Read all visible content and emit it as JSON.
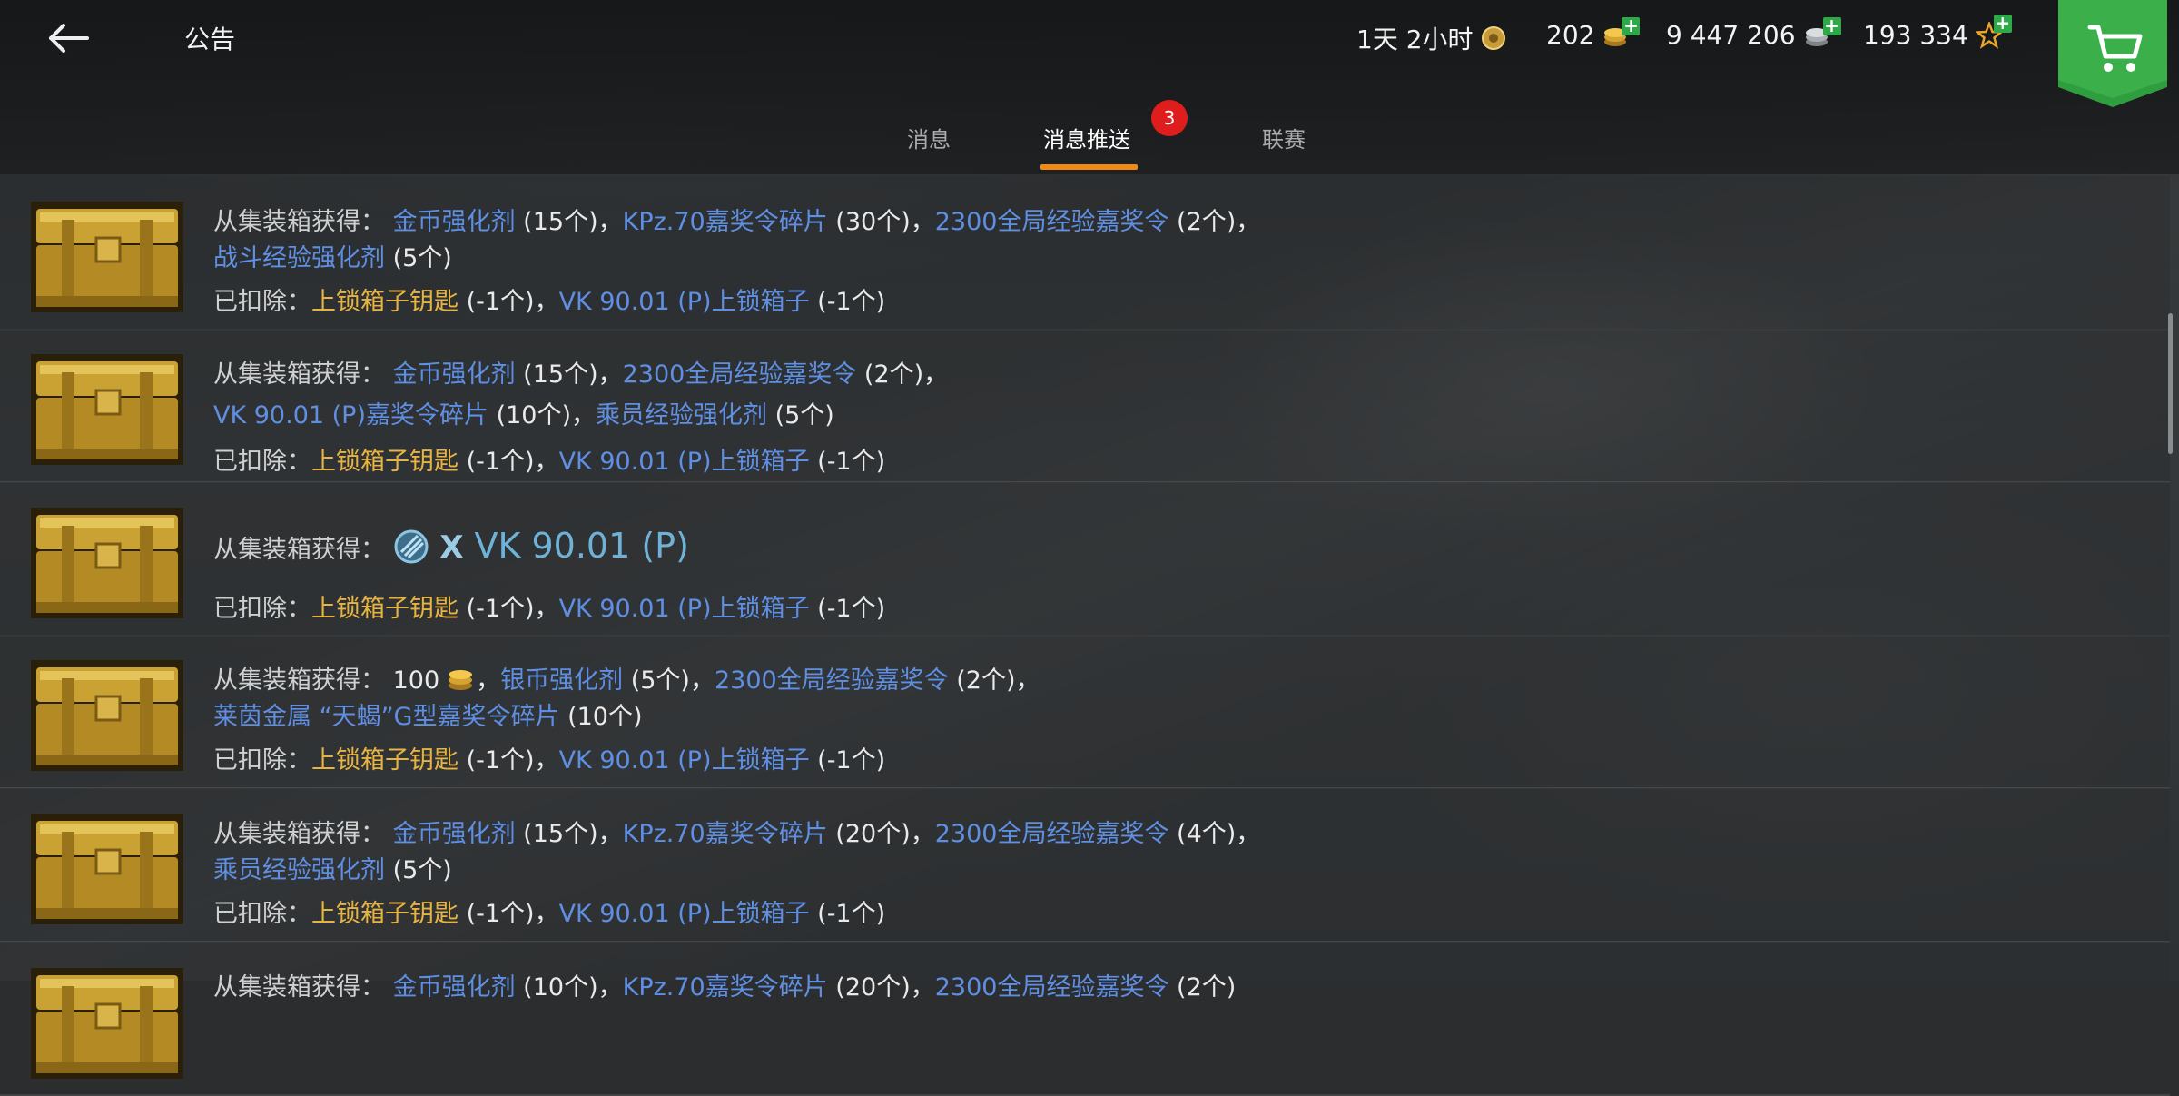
{
  "header": {
    "title": "公告",
    "timer": "1天 2小时",
    "gold": "202",
    "credits": "9 447 206",
    "free_xp": "193 334"
  },
  "tabs": [
    {
      "label": "消息",
      "active": false
    },
    {
      "label": "消息推送",
      "active": true,
      "badge": "3"
    },
    {
      "label": "联赛",
      "active": false
    }
  ],
  "common": {
    "got_label": "从集装箱获得：",
    "deducted_label": "已扣除：",
    "comma": "，",
    "comma_short": ",",
    "key": "上锁箱子钥匙",
    "minus_one": "(-1个)",
    "locked_box": "VK 90.01 (P)上锁箱子"
  },
  "rows": [
    {
      "l1": [
        {
          "t": "金币强化剂",
          "c": "blue"
        },
        {
          "t": " (15个)",
          "c": "w"
        },
        {
          "t": "，",
          "c": "w"
        },
        {
          "t": "KPz.70嘉奖令碎片",
          "c": "blue"
        },
        {
          "t": " (30个)",
          "c": "w"
        },
        {
          "t": "，",
          "c": "w"
        },
        {
          "t": "2300全局经验嘉奖令",
          "c": "blue"
        },
        {
          "t": " (2个)",
          "c": "w"
        },
        {
          "t": "，",
          "c": "w"
        }
      ],
      "l2": [
        {
          "t": "战斗经验强化剂",
          "c": "blue"
        },
        {
          "t": " (5个)",
          "c": "w"
        }
      ]
    },
    {
      "l1": [
        {
          "t": "金币强化剂",
          "c": "blue"
        },
        {
          "t": " (15个)",
          "c": "w"
        },
        {
          "t": "，",
          "c": "w"
        },
        {
          "t": "2300全局经验嘉奖令",
          "c": "blue"
        },
        {
          "t": " (2个)",
          "c": "w"
        },
        {
          "t": "，",
          "c": "w"
        }
      ],
      "l2": [
        {
          "t": "VK 90.01 (P)嘉奖令碎片",
          "c": "blue"
        },
        {
          "t": " (10个)",
          "c": "w"
        },
        {
          "t": "，",
          "c": "w"
        },
        {
          "t": "乘员经验强化剂",
          "c": "blue"
        },
        {
          "t": " (5个)",
          "c": "w"
        }
      ]
    },
    {
      "special": {
        "x": "X",
        "tank": "VK 90.01 (P)"
      }
    },
    {
      "l1": [
        {
          "t": "100",
          "c": "w"
        },
        {
          "t": "GOLDICON",
          "c": "icon"
        },
        {
          "t": "，",
          "c": "w"
        },
        {
          "t": "银币强化剂",
          "c": "blue"
        },
        {
          "t": " (5个)",
          "c": "w"
        },
        {
          "t": "，",
          "c": "w"
        },
        {
          "t": "2300全局经验嘉奖令",
          "c": "blue"
        },
        {
          "t": " (2个)",
          "c": "w"
        },
        {
          "t": "，",
          "c": "w"
        }
      ],
      "l2": [
        {
          "t": "莱茵金属 “天蝎”G型嘉奖令碎片",
          "c": "blue"
        },
        {
          "t": " (10个)",
          "c": "w"
        }
      ]
    },
    {
      "l1": [
        {
          "t": "金币强化剂",
          "c": "blue"
        },
        {
          "t": " (15个)",
          "c": "w"
        },
        {
          "t": "，",
          "c": "w"
        },
        {
          "t": "KPz.70嘉奖令碎片",
          "c": "blue"
        },
        {
          "t": " (20个)",
          "c": "w"
        },
        {
          "t": "，",
          "c": "w"
        },
        {
          "t": "2300全局经验嘉奖令",
          "c": "blue"
        },
        {
          "t": " (4个)",
          "c": "w"
        },
        {
          "t": "，",
          "c": "w"
        }
      ],
      "l2": [
        {
          "t": "乘员经验强化剂",
          "c": "blue"
        },
        {
          "t": " (5个)",
          "c": "w"
        }
      ]
    },
    {
      "l1": [
        {
          "t": "金币强化剂",
          "c": "blue"
        },
        {
          "t": " (10个)",
          "c": "w"
        },
        {
          "t": "，",
          "c": "w"
        },
        {
          "t": "KPz.70嘉奖令碎片",
          "c": "blue"
        },
        {
          "t": " (20个)",
          "c": "w"
        },
        {
          "t": "，",
          "c": "w"
        },
        {
          "t": "2300全局经验嘉奖令",
          "c": "blue"
        },
        {
          "t": " (2个)",
          "c": "w"
        }
      ]
    }
  ],
  "colors": {
    "accent": "#f08a14",
    "link": "#5f8fe3",
    "gold_text": "#e7b443",
    "badge": "#e01d1d",
    "cart": "#2f9e3e"
  }
}
